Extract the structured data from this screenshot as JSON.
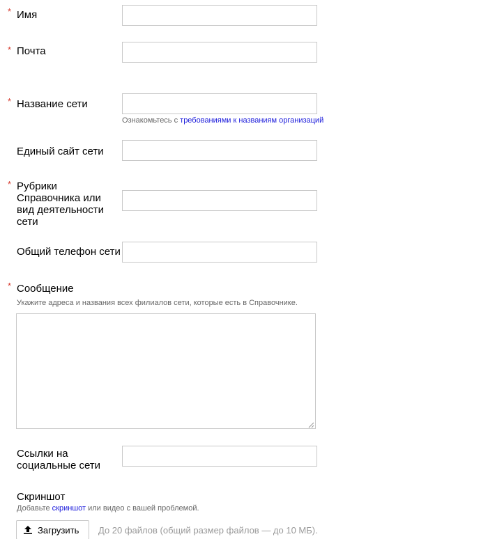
{
  "required_mark": "*",
  "fields": {
    "name": {
      "label": "Имя",
      "value": ""
    },
    "email": {
      "label": "Почта",
      "value": ""
    },
    "network_name": {
      "label": "Название сети",
      "value": "",
      "hint_prefix": "Ознакомьтесь с ",
      "hint_link": "требованиями к названиям организаций"
    },
    "network_site": {
      "label": "Единый сайт сети",
      "value": ""
    },
    "rubrics": {
      "label_line1": "Рубрики",
      "label_line2": "Справочника или",
      "label_line3": "вид деятельности",
      "label_line4": "сети",
      "value": ""
    },
    "phone": {
      "label": "Общий телефон сети",
      "value": ""
    },
    "message": {
      "label": "Сообщение",
      "hint": "Укажите адреса и названия всех филиалов сети, которые есть в Справочнике.",
      "value": ""
    },
    "social": {
      "label_line1": "Ссылки на",
      "label_line2": "социальные сети",
      "value": ""
    }
  },
  "screenshot": {
    "label": "Скриншот",
    "hint_prefix": "Добавьте ",
    "hint_link": "скриншот",
    "hint_suffix": " или видео с вашей проблемой.",
    "upload_button": "Загрузить",
    "upload_note": "До 20 файлов (общий размер файлов — до 10 МБ).",
    "upload_icon": "upload-arrow-icon"
  },
  "colors": {
    "required": "#d63b2f",
    "link": "#1a1adb",
    "hint": "#666666",
    "border": "#c8c8c8"
  }
}
